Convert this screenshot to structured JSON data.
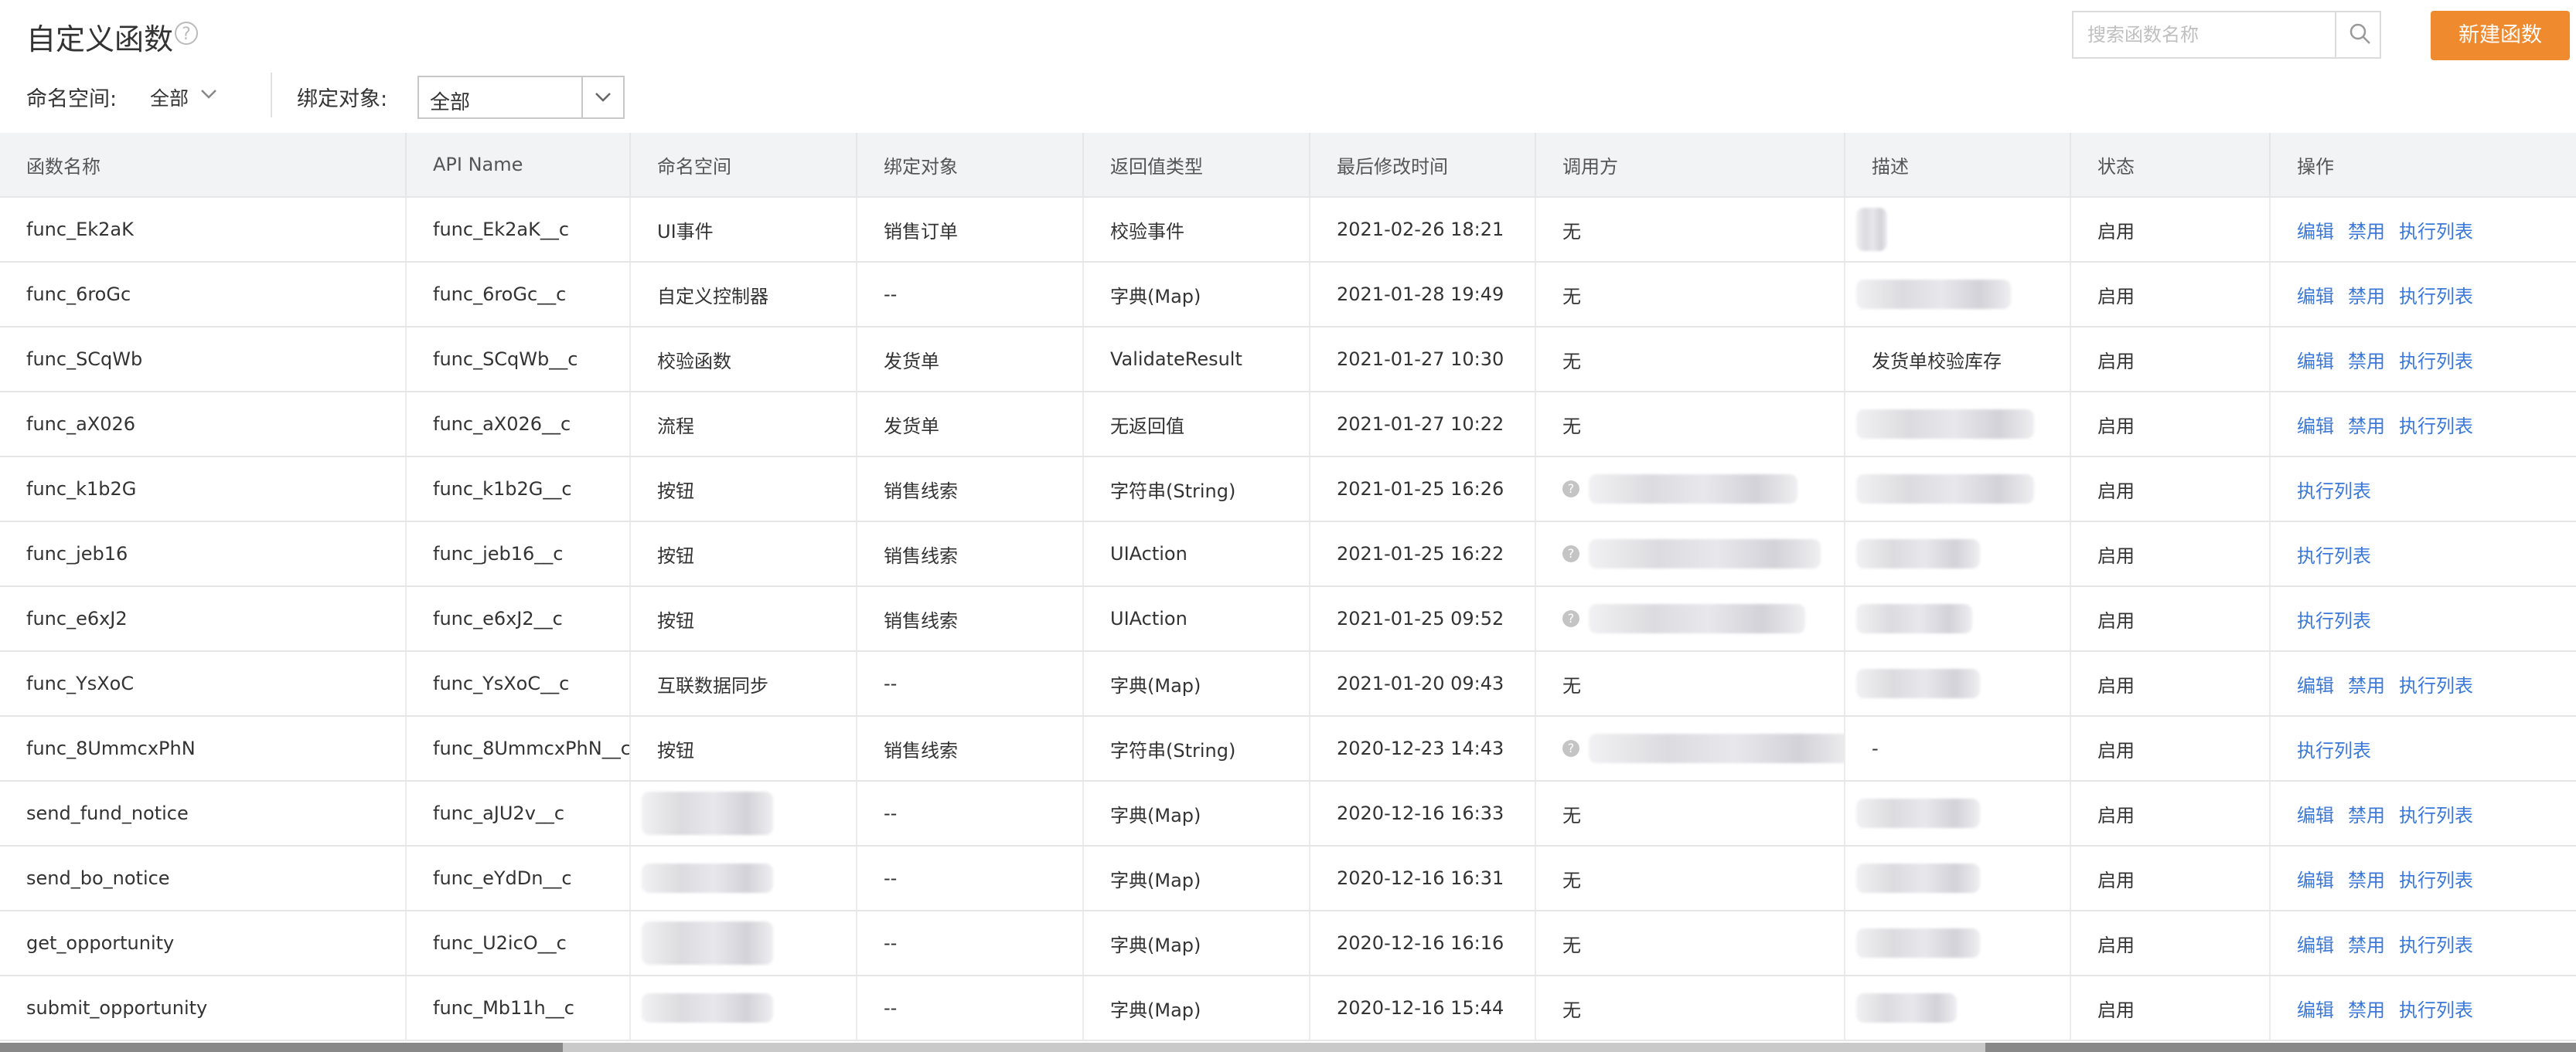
{
  "page": {
    "title": "自定义函数"
  },
  "search": {
    "placeholder": "搜索函数名称"
  },
  "new_button": {
    "label": "新建函数"
  },
  "filters": {
    "namespace_label": "命名空间:",
    "namespace_value": "全部",
    "bind_label": "绑定对象:",
    "bind_value": "全部"
  },
  "table": {
    "columns": [
      "函数名称",
      "API Name",
      "命名空间",
      "绑定对象",
      "返回值类型",
      "最后修改时间",
      "调用方",
      "描述",
      "状态",
      "操作"
    ],
    "actions": {
      "edit": "编辑",
      "disable": "禁用",
      "exec_list": "执行列表"
    },
    "rows": [
      {
        "name": "func_Ek2aK",
        "api": "func_Ek2aK__c",
        "ns": "UI事件",
        "bind": "销售订单",
        "ret": "校验事件",
        "time": "2021-02-26 18:21",
        "caller": "无",
        "desc": "",
        "status": "启用",
        "ops": "full"
      },
      {
        "name": "func_6roGc",
        "api": "func_6roGc__c",
        "ns": "自定义控制器",
        "bind": "--",
        "ret": "字典(Map)",
        "time": "2021-01-28 19:49",
        "caller": "无",
        "desc": "",
        "status": "启用",
        "ops": "full"
      },
      {
        "name": "func_SCqWb",
        "api": "func_SCqWb__c",
        "ns": "校验函数",
        "bind": "发货单",
        "ret": "ValidateResult",
        "time": "2021-01-27 10:30",
        "caller": "无",
        "desc": "发货单校验库存",
        "status": "启用",
        "ops": "full"
      },
      {
        "name": "func_aX026",
        "api": "func_aX026__c",
        "ns": "流程",
        "bind": "发货单",
        "ret": "无返回值",
        "time": "2021-01-27 10:22",
        "caller": "无",
        "desc": "",
        "status": "启用",
        "ops": "full"
      },
      {
        "name": "func_k1b2G",
        "api": "func_k1b2G__c",
        "ns": "按钮",
        "bind": "销售线索",
        "ret": "字符串(String)",
        "time": "2021-01-25 16:26",
        "caller": "",
        "desc": "",
        "status": "启用",
        "ops": "exec"
      },
      {
        "name": "func_jeb16",
        "api": "func_jeb16__c",
        "ns": "按钮",
        "bind": "销售线索",
        "ret": "UIAction",
        "time": "2021-01-25 16:22",
        "caller": "",
        "desc": "",
        "status": "启用",
        "ops": "exec"
      },
      {
        "name": "func_e6xJ2",
        "api": "func_e6xJ2__c",
        "ns": "按钮",
        "bind": "销售线索",
        "ret": "UIAction",
        "time": "2021-01-25 09:52",
        "caller": "",
        "desc": "",
        "status": "启用",
        "ops": "exec"
      },
      {
        "name": "func_YsXoC",
        "api": "func_YsXoC__c",
        "ns": "互联数据同步",
        "bind": "--",
        "ret": "字典(Map)",
        "time": "2021-01-20 09:43",
        "caller": "无",
        "desc": "",
        "status": "启用",
        "ops": "full"
      },
      {
        "name": "func_8UmmcxPhN",
        "api": "func_8UmmcxPhN__c",
        "ns": "按钮",
        "bind": "销售线索",
        "ret": "字符串(String)",
        "time": "2020-12-23 14:43",
        "caller": "",
        "desc": "-",
        "status": "启用",
        "ops": "exec"
      },
      {
        "name": "send_fund_notice",
        "api": "func_aJU2v__c",
        "ns": "",
        "bind": "--",
        "ret": "字典(Map)",
        "time": "2020-12-16 16:33",
        "caller": "无",
        "desc": "",
        "status": "启用",
        "ops": "full"
      },
      {
        "name": "send_bo_notice",
        "api": "func_eYdDn__c",
        "ns": "",
        "bind": "--",
        "ret": "字典(Map)",
        "time": "2020-12-16 16:31",
        "caller": "无",
        "desc": "",
        "status": "启用",
        "ops": "full"
      },
      {
        "name": "get_opportunity",
        "api": "func_U2icO__c",
        "ns": "",
        "bind": "--",
        "ret": "字典(Map)",
        "time": "2020-12-16 16:16",
        "caller": "无",
        "desc": "",
        "status": "启用",
        "ops": "full"
      },
      {
        "name": "submit_opportunity",
        "api": "func_Mb11h__c",
        "ns": "",
        "bind": "--",
        "ret": "字典(Map)",
        "time": "2020-12-16 15:44",
        "caller": "无",
        "desc": "",
        "status": "启用",
        "ops": "full"
      }
    ]
  },
  "colors": {
    "accent": "#f08a2e",
    "link": "#3b78d8",
    "header_bg": "#f2f3f5"
  },
  "icons": {
    "help": "question-icon",
    "search": "search-icon",
    "chevron": "chevron-down-icon"
  }
}
